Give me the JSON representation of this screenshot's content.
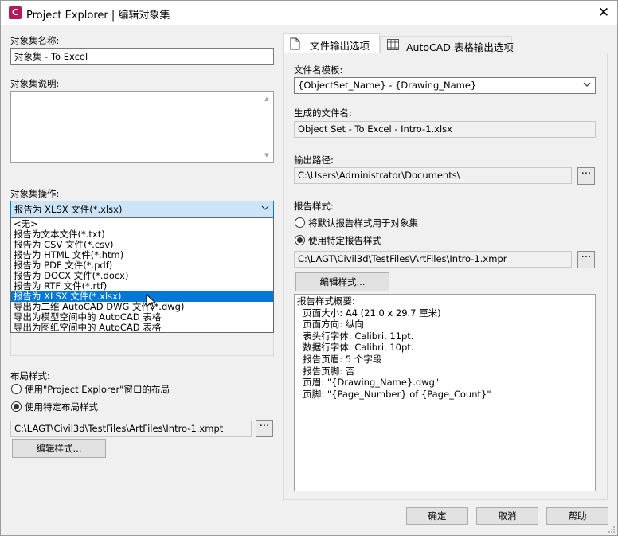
{
  "window": {
    "title": "Project Explorer | 编辑对象集",
    "app_icon_letter": "C",
    "close_glyph": "✕"
  },
  "left": {
    "name_label": "对象集名称:",
    "name_value": "对象集 - To Excel",
    "description_label": "对象集说明:",
    "operation_label": "对象集操作:",
    "operation_selected": "报告为 XLSX 文件(*.xlsx)",
    "operation_options": [
      "<无>",
      "报告为文本文件(*.txt)",
      "报告为 CSV 文件(*.csv)",
      "报告为 HTML 文件(*.htm)",
      "报告为 PDF 文件(*.pdf)",
      "报告为 DOCX 文件(*.docx)",
      "报告为 RTF 文件(*.rtf)",
      "报告为 XLSX 文件(*.xlsx)",
      "导出为二维 AutoCAD DWG 文件(*.dwg)",
      "导出为模型空间中的 AutoCAD 表格",
      "导出为图纸空间中的 AutoCAD 表格"
    ],
    "layout_label": "布局样式:",
    "layout_option_window": "使用\"Project Explorer\"窗口的布局",
    "layout_option_specific": "使用特定布局样式",
    "layout_path": "C:\\LAGT\\Civil3d\\TestFiles\\ArtFiles\\Intro-1.xmpt",
    "edit_style_button": "编辑样式..."
  },
  "tabs": {
    "file_output": "文件输出选项",
    "autocad_table": "AutoCAD 表格输出选项"
  },
  "right": {
    "filename_template_label": "文件名模板:",
    "filename_template_value": "{ObjectSet_Name} - {Drawing_Name}",
    "generated_name_label": "生成的文件名:",
    "generated_name_value": "Object Set - To Excel - Intro-1.xlsx",
    "output_path_label": "输出路径:",
    "output_path_value": "C:\\Users\\Administrator\\Documents\\",
    "report_style_label": "报告样式:",
    "report_option_default": "将默认报告样式用于对象集",
    "report_option_specific": "使用特定报告样式",
    "report_style_path": "C:\\LAGT\\Civil3d\\TestFiles\\ArtFiles\\Intro-1.xmpr",
    "edit_style_button": "编辑样式...",
    "summary_lines": [
      "报告样式概要:",
      "  页面大小: A4 (21.0 x 29.7 厘米)",
      "  页面方向: 纵向",
      "  表头行字体: Calibri, 11pt.",
      "  数据行字体: Calibri, 10pt.",
      "  报告页眉: 5 个字段",
      "  报告页脚: 否",
      "  页眉: \"{Drawing_Name}.dwg\"",
      "  页脚: \"{Page_Number} of {Page_Count}\""
    ],
    "ellipsis": "···"
  },
  "footer": {
    "ok": "确定",
    "cancel": "取消",
    "help": "帮助"
  },
  "colors": {
    "selection_blue": "#0078d7",
    "combo_highlight": "#cce4f7",
    "app_icon": "#b31b58"
  }
}
